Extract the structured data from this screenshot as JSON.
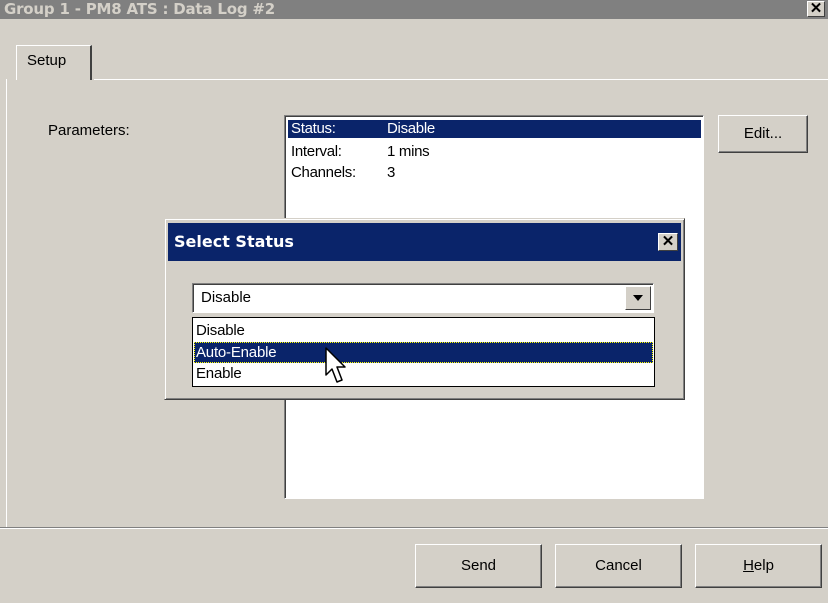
{
  "window": {
    "title": "Group 1 - PM8 ATS : Data Log #2",
    "close_glyph": "✕"
  },
  "tabs": [
    {
      "label": "Setup",
      "selected": true
    }
  ],
  "parameters": {
    "label": "Parameters:",
    "rows": [
      {
        "key": "Status:",
        "value": "Disable",
        "selected": true
      },
      {
        "key": "Interval:",
        "value": "1 mins",
        "selected": false
      },
      {
        "key": "Channels:",
        "value": "3",
        "selected": false
      }
    ],
    "edit_label": "Edit..."
  },
  "footer": {
    "send_label": "Send",
    "cancel_label": "Cancel",
    "help_label_mnemonic": "H",
    "help_label_rest": "elp"
  },
  "select_status_dialog": {
    "title": "Select Status",
    "close_glyph": "✕",
    "combo_value": "Disable",
    "options": [
      {
        "label": "Disable",
        "highlighted": false
      },
      {
        "label": "Auto-Enable",
        "highlighted": true
      },
      {
        "label": "Enable",
        "highlighted": false
      }
    ]
  },
  "colors": {
    "face": "#d4d0c8",
    "selection": "#0a246a",
    "inactive_title": "#808080"
  }
}
